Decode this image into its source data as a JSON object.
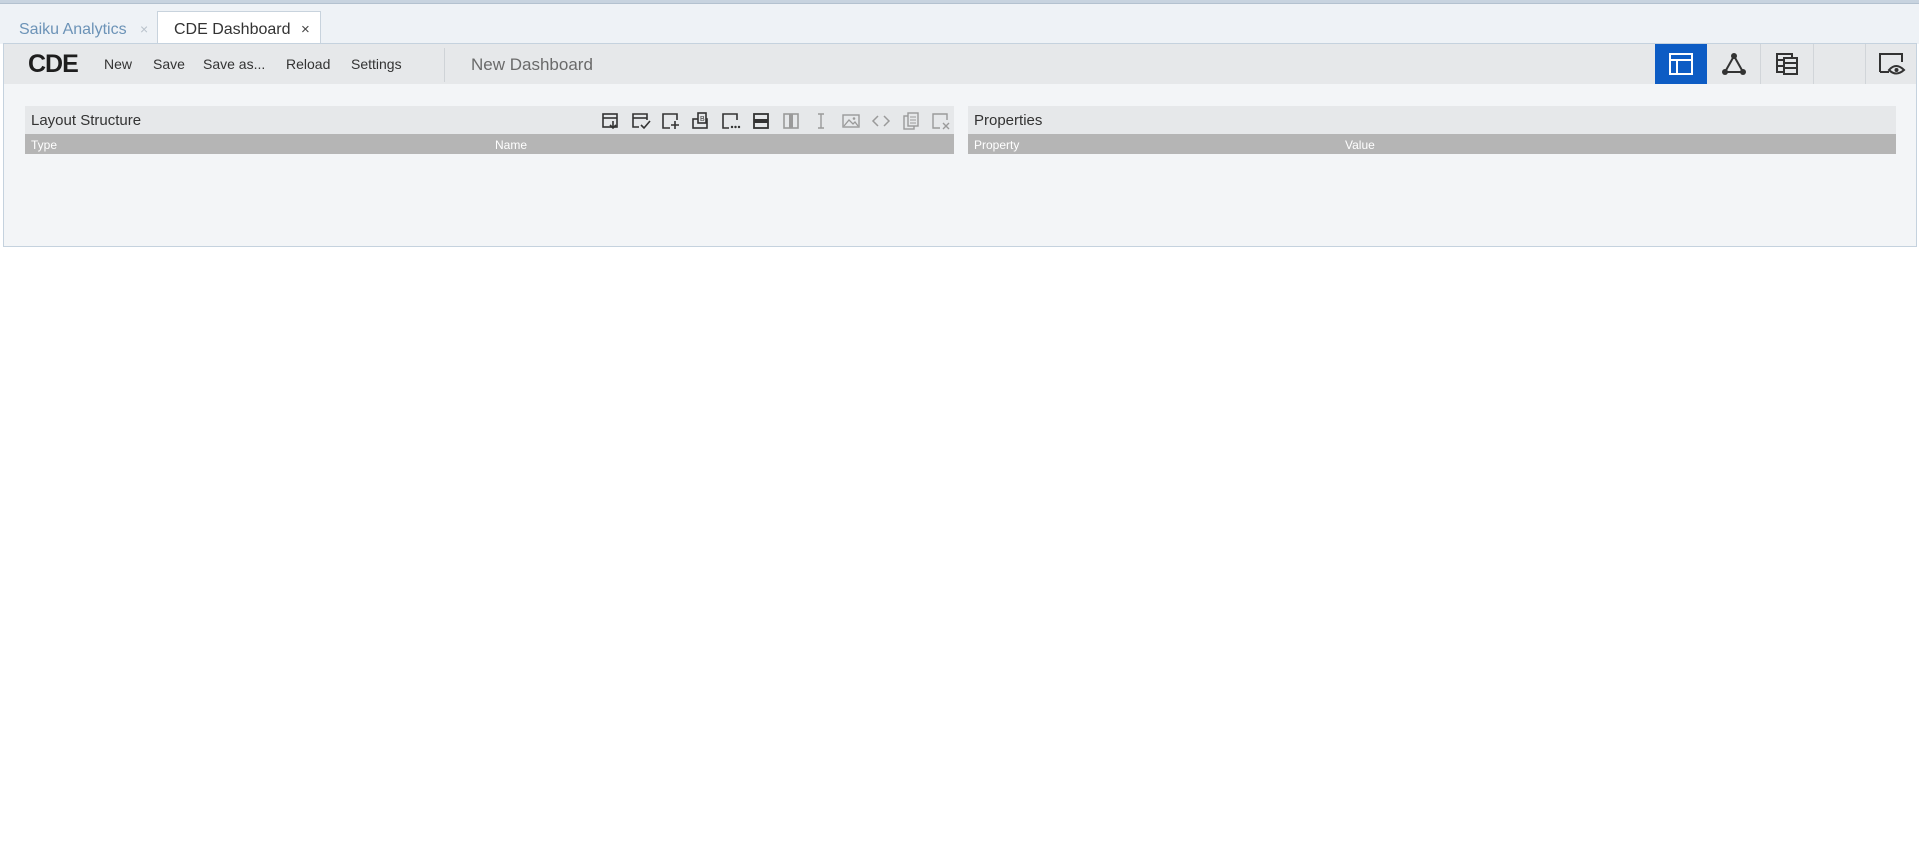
{
  "tabs": [
    {
      "label": "Saiku Analytics",
      "close": "×"
    },
    {
      "label": "CDE Dashboard",
      "close": "×"
    }
  ],
  "toolbar": {
    "logo": "CDE",
    "menu": {
      "new": "New",
      "save": "Save",
      "save_as": "Save as...",
      "reload": "Reload",
      "settings": "Settings"
    },
    "dashboard_title": "New Dashboard",
    "modes": [
      "layout-panel-icon",
      "components-panel-icon",
      "datasources-panel-icon",
      "preview-icon"
    ],
    "active_mode_color": "#0d5cc4"
  },
  "layout_panel": {
    "title": "Layout Structure",
    "columns": [
      "Type",
      "Name"
    ],
    "tools": [
      "save-template-icon",
      "apply-template-icon",
      "add-resource-icon",
      "add-bootstrap-panel-icon",
      "add-freeform-icon",
      "add-row-icon",
      "add-column-icon",
      "add-space-icon",
      "add-image-icon",
      "add-html-icon",
      "duplicate-icon",
      "delete-icon"
    ]
  },
  "properties_panel": {
    "title": "Properties",
    "columns": [
      "Property",
      "Value"
    ]
  }
}
